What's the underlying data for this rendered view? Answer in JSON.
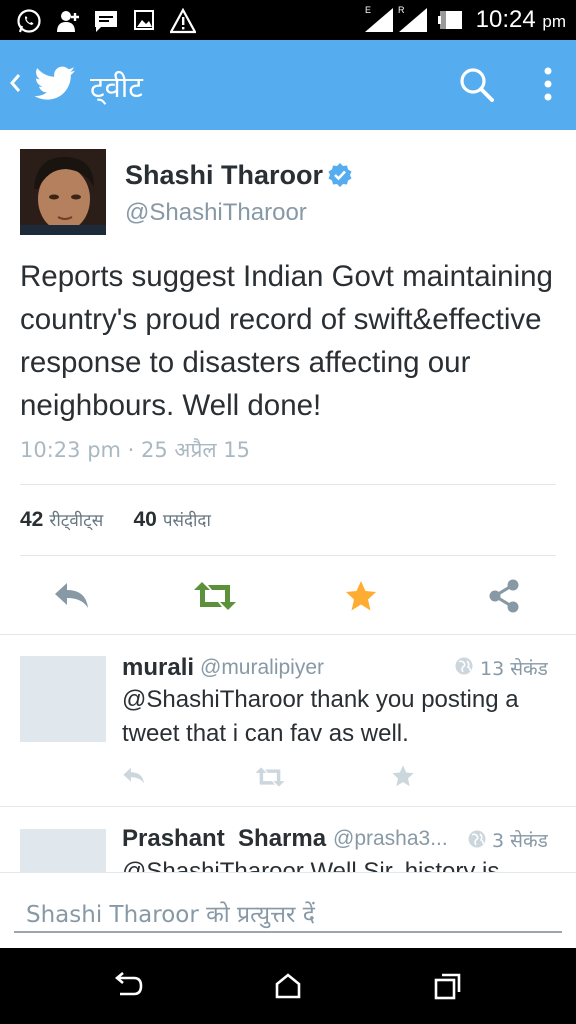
{
  "status_bar": {
    "time": "10:24",
    "ampm": "pm",
    "icons": [
      "whatsapp-icon",
      "add-contact-icon",
      "message-icon",
      "image-icon",
      "warning-icon",
      "signal-icon",
      "battery-icon"
    ],
    "network_label_e": "E",
    "network_label_r": "R"
  },
  "app_bar": {
    "title": "ट्वीट",
    "color": "#55acee"
  },
  "tweet": {
    "author_name": "Shashi Tharoor",
    "author_handle": "@ShashiTharoor",
    "text": "Reports suggest Indian Govt maintaining country's proud record of swift&effective response to disasters affecting our neighbours. Well done!",
    "timestamp": "10:23 pm · 25 अप्रैल 15",
    "retweets_count": "42",
    "retweets_label": "रीट्वीट्स",
    "favorites_count": "40",
    "favorites_label": "पसंदीदा"
  },
  "actions": {
    "retweet_color": "#5c913b",
    "favorite_color": "#ffac33",
    "icon_color": "#8899a6"
  },
  "replies": [
    {
      "name": "murali",
      "handle": "@muralipiyer",
      "time": "13 सेकंड",
      "text": "@ShashiTharoor thank you posting a tweet that i can fav as well."
    },
    {
      "name": "Prashant  Sharma",
      "handle": "@prasha3...",
      "time": "3 सेकंड",
      "text": "@ShashiTharoor Well Sir, history is"
    }
  ],
  "composer": {
    "placeholder": "Shashi Tharoor को प्रत्युत्तर दें"
  }
}
